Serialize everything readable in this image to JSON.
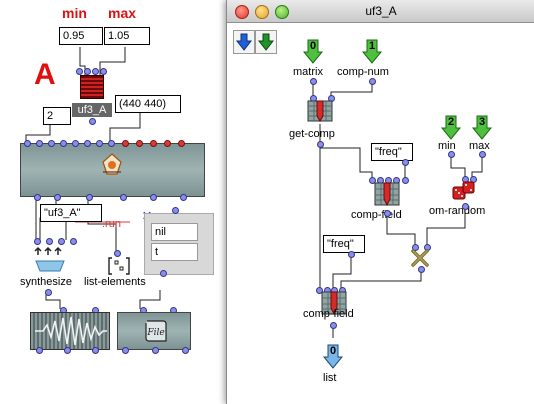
{
  "left_patch": {
    "min_label": "min",
    "max_label": "max",
    "min_value": "0.95",
    "max_value": "1.05",
    "letter": "A",
    "list_value": "(440 440)",
    "num_value": "2",
    "box_label": "uf3_A",
    "string_value": "\"uf3_A\"",
    "run_label": ".run",
    "menu_items": [
      "nil",
      "t"
    ],
    "synthesize_label": "synthesize",
    "list_elements_label": "list-elements"
  },
  "window": {
    "title": "uf3_A",
    "inputs": [
      {
        "index": "0",
        "name": "matrix"
      },
      {
        "index": "1",
        "name": "comp-num"
      },
      {
        "index": "2",
        "name": "min"
      },
      {
        "index": "3",
        "name": "max"
      }
    ],
    "get_comp_label": "get-comp",
    "comp_field_label": "comp-field",
    "freq_value": "\"freq\"",
    "om_random_label": "om-random",
    "output": {
      "index": "0",
      "name": "list"
    }
  }
}
